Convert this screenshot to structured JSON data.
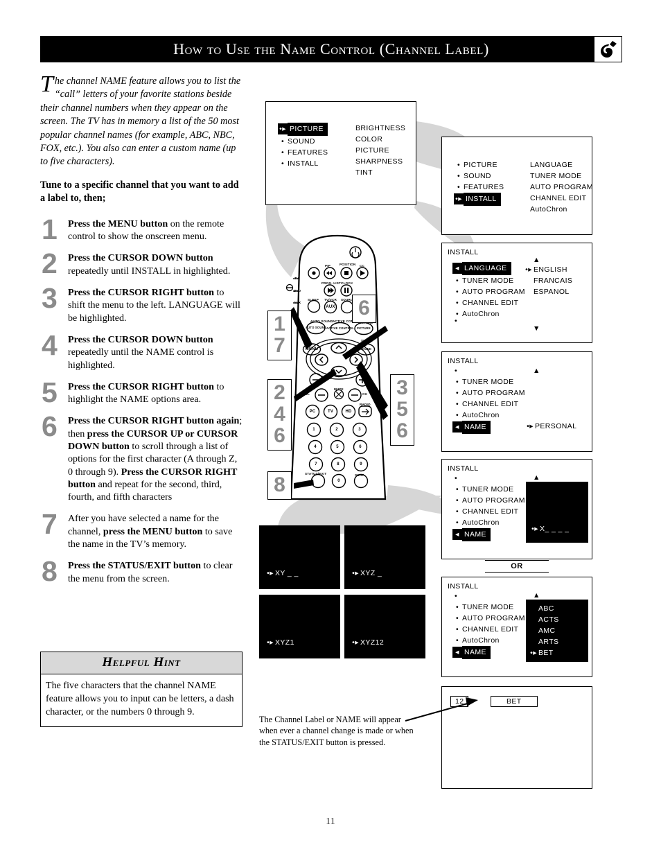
{
  "header": {
    "title": "How to Use the Name Control (Channel Label)",
    "logo_icon": "philips-shield-logo"
  },
  "intro": {
    "dropcap": "T",
    "text": "he channel NAME feature allows you to list the “call” letters of your favorite stations beside their channel numbers when they appear on the screen.  The TV has in memory a list of the 50 most popular channel names (for example, ABC, NBC, FOX, etc.).  You also can enter a custom name (up to five characters).",
    "tune_line": "Tune to a specific channel that you want to add a label to, then;"
  },
  "steps": [
    {
      "num": "1",
      "html": "<b>Press the MENU button</b> on the remote control to show the onscreen menu."
    },
    {
      "num": "2",
      "html": "<b>Press the CURSOR DOWN button</b> repeatedly until INSTALL in highlighted."
    },
    {
      "num": "3",
      "html": "<b>Press the CURSOR RIGHT button</b> to shift the menu to the left. LANGUAGE will be highlighted."
    },
    {
      "num": "4",
      "html": "<b>Press the CURSOR DOWN button</b> repeatedly until the NAME control is highlighted."
    },
    {
      "num": "5",
      "html": "<b>Press the CURSOR RIGHT button</b> to highlight the NAME options area."
    },
    {
      "num": "6",
      "html": "<b>Press the CURSOR RIGHT button again</b>; then <b>press the CURSOR UP or CURSOR DOWN button</b> to scroll through a list of options for the first character (A through Z, 0 through 9).  <b>Press the CURSOR RIGHT button</b> and repeat for the second, third, fourth, and fifth characters"
    },
    {
      "num": "7",
      "html": "After you have selected a name for the channel, <b>press the MENU button</b> to save the name in the TV’s memory."
    },
    {
      "num": "8",
      "html": "<b>Press the STATUS/EXIT button</b> to clear the menu from the screen."
    }
  ],
  "hint": {
    "title": "Helpful Hint",
    "body": "The five characters that the channel NAME feature allows you to input can be letters, a dash character, or the numbers 0 through 9."
  },
  "osd_screens": {
    "main_menu": {
      "left_items": [
        "PICTURE",
        "SOUND",
        "FEATURES",
        "INSTALL"
      ],
      "highlighted": "PICTURE",
      "right_items": [
        "BRIGHTNESS",
        "COLOR",
        "PICTURE",
        "SHARPNESS",
        "TINT"
      ]
    },
    "install_menu": {
      "left_items": [
        "PICTURE",
        "SOUND",
        "FEATURES",
        "INSTALL"
      ],
      "highlighted": "INSTALL",
      "right_items": [
        "LANGUAGE",
        "TUNER MODE",
        "AUTO PROGRAM",
        "CHANNEL EDIT",
        "AutoChron"
      ]
    },
    "language_screen": {
      "title": "INSTALL",
      "left_items": [
        "LANGUAGE",
        "TUNER MODE",
        "AUTO PROGRAM",
        "CHANNEL EDIT",
        "AutoChron"
      ],
      "highlighted": "LANGUAGE",
      "right_items": [
        "ENGLISH",
        "FRANCAIS",
        "ESPANOL"
      ],
      "right_selected": "ENGLISH",
      "scroll_up": "▲",
      "scroll_down": "▼"
    },
    "name_screen": {
      "title": "INSTALL",
      "left_items": [
        "TUNER MODE",
        "AUTO PROGRAM",
        "CHANNEL EDIT",
        "AutoChron",
        "NAME"
      ],
      "highlighted": "NAME",
      "right_value": "PERSONAL",
      "scroll_up": "▲"
    },
    "personal_screen": {
      "title": "INSTALL",
      "left_items": [
        "TUNER MODE",
        "AUTO PROGRAM",
        "CHANNEL EDIT",
        "AutoChron",
        "NAME"
      ],
      "entry_value": "X_ _ _ _",
      "scroll_up": "▲"
    },
    "preset_screen": {
      "title": "INSTALL",
      "left_items": [
        "TUNER MODE",
        "AUTO PROGRAM",
        "CHANNEL EDIT",
        "AutoChron",
        "NAME"
      ],
      "preset_items": [
        "ABC",
        "ACTS",
        "AMC",
        "ARTS",
        "BET"
      ],
      "preset_selected": "BET",
      "scroll_up": "▲"
    },
    "final_screen": {
      "channel_number": "12",
      "channel_label": "BET"
    },
    "entry_examples": [
      {
        "value": "XY _ _"
      },
      {
        "value": "XYZ _"
      },
      {
        "value": "XYZ1"
      },
      {
        "value": "XYZ12"
      }
    ]
  },
  "or_label": "OR",
  "caption": "The Channel Label or NAME will appear when ever a channel change is made or when the STATUS/EXIT button is pressed.",
  "callouts": {
    "left_top": "1\n7",
    "left_mid": "2\n4\n6",
    "left_bottom": "8",
    "right_top": "6",
    "right_mid": "3\n5\n6"
  },
  "remote": {
    "labels": {
      "pip": "PIP",
      "position": "POSITION",
      "cc": "CC",
      "prog_list": "PROG. LIST",
      "clock": "CLOCK",
      "sleep": "SLEEP",
      "tv_vcr": "TV/VCR",
      "source": "SOURCE",
      "auto_sound": "AUTO SOUND",
      "active_control": "ACTIVE CONTROL",
      "picture": "PICTURE",
      "surr": "SURR.",
      "menu": "MENU",
      "sound": "SOUND",
      "vol": "VOL",
      "mute": "MUTE",
      "ch": "CH",
      "radio": "RADIO",
      "status_exit": "STATUS/EXIT",
      "surf": "SURF",
      "side_tv": "TV",
      "side_dvd": "DVD",
      "side_aux": "AUX",
      "aux_btn": "AUX"
    },
    "device_buttons": [
      "PC",
      "TV",
      "HD"
    ],
    "keypad": [
      "1",
      "2",
      "3",
      "4",
      "5",
      "6",
      "7",
      "8",
      "9",
      "0"
    ]
  },
  "page_number": "11"
}
